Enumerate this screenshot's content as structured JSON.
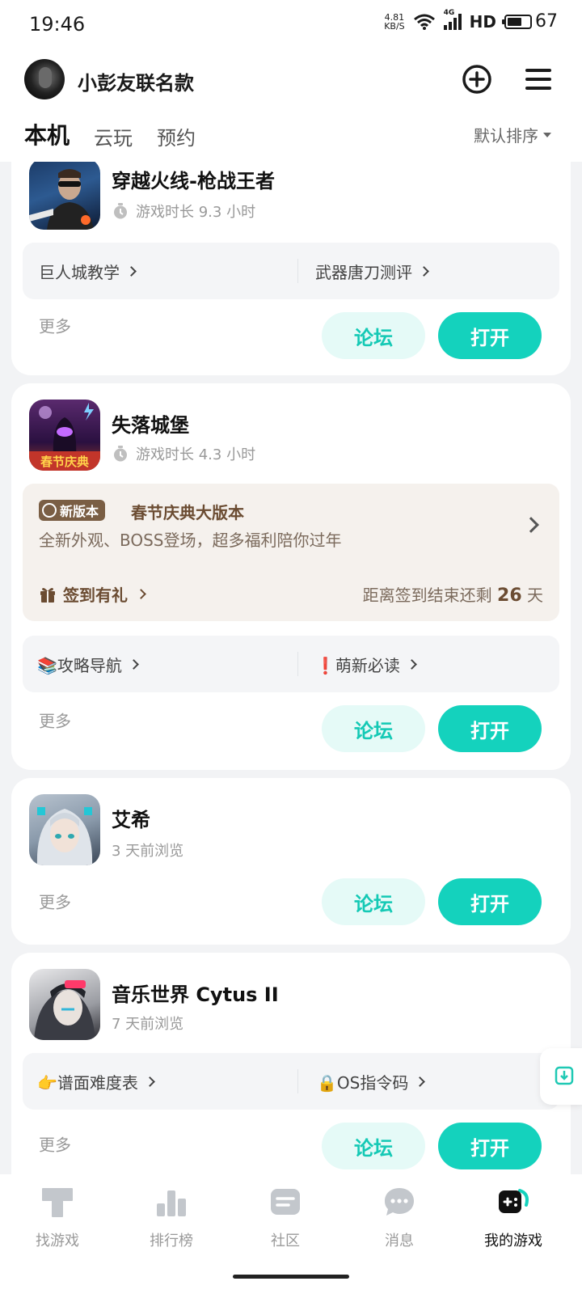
{
  "status_bar": {
    "time": "19:46",
    "net_speed_value": "4.81",
    "net_speed_unit": "KB/S",
    "network": "4G",
    "hd": "HD",
    "battery": "67",
    "battery_level": 0.67
  },
  "header": {
    "username": "小彭友联名款",
    "add_icon": "plus-circle-icon",
    "menu_icon": "hamburger-menu-icon"
  },
  "tabs": [
    {
      "label": "本机",
      "active": true
    },
    {
      "label": "云玩",
      "active": false
    },
    {
      "label": "预约",
      "active": false
    }
  ],
  "sort": {
    "label": "默认排序"
  },
  "games": [
    {
      "name": "穿越火线-枪战王者",
      "meta": "游戏时长 9.3 小时",
      "links": [
        "巨人城教学",
        "武器唐刀测评"
      ],
      "more": "更多",
      "forum": "论坛",
      "open": "打开"
    },
    {
      "name": "失落城堡",
      "icon_caption": "春节庆典",
      "meta": "游戏时长 4.3 小时",
      "event": {
        "tag": "新版本",
        "title": "春节庆典大版本",
        "desc": "全新外观、BOSS登场，超多福利陪你过年",
        "sign": "签到有礼",
        "countdown_prefix": "距离签到结束还剩",
        "countdown_days": "26",
        "countdown_suffix": "天"
      },
      "links": [
        "📚攻略导航",
        "❗萌新必读"
      ],
      "more": "更多",
      "forum": "论坛",
      "open": "打开"
    },
    {
      "name": "艾希",
      "meta": "3 天前浏览",
      "more": "更多",
      "forum": "论坛",
      "open": "打开"
    },
    {
      "name": "音乐世界 Cytus II",
      "meta": "7 天前浏览",
      "links": [
        "👉谱面难度表",
        "🔒OS指令码"
      ],
      "more": "更多",
      "forum": "论坛",
      "open": "打开"
    }
  ],
  "bottom_nav": [
    {
      "label": "找游戏",
      "icon": "find-game-icon",
      "active": false
    },
    {
      "label": "排行榜",
      "icon": "ranking-icon",
      "active": false
    },
    {
      "label": "社区",
      "icon": "community-icon",
      "active": false
    },
    {
      "label": "消息",
      "icon": "message-icon",
      "active": false
    },
    {
      "label": "我的游戏",
      "icon": "gamepad-icon",
      "active": true
    }
  ],
  "colors": {
    "accent": "#14d2bd",
    "accent_light": "#e5faf7",
    "event_brown": "#6b4c32"
  }
}
